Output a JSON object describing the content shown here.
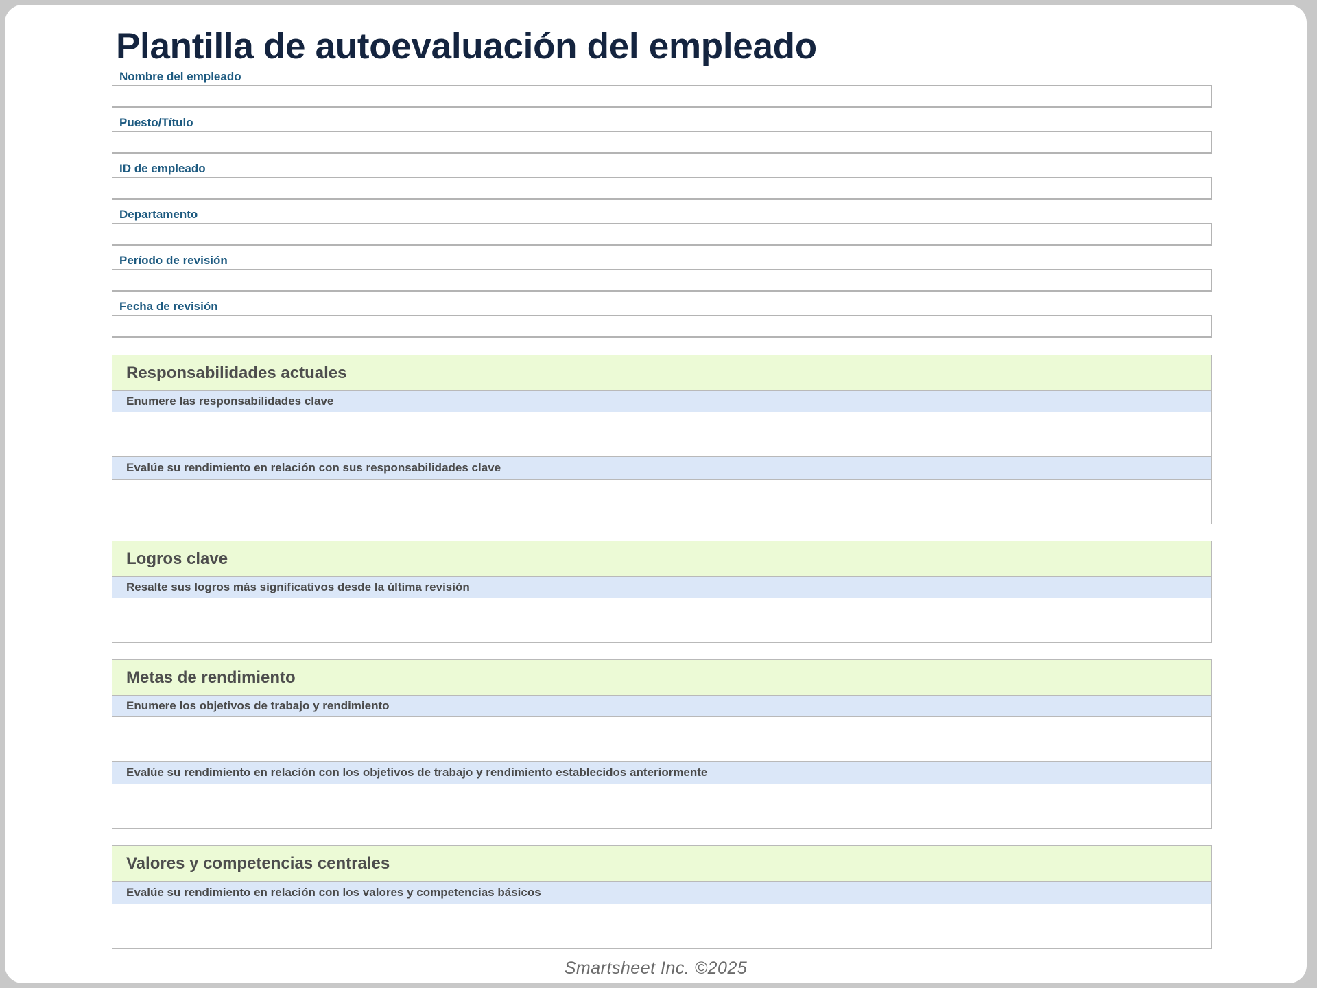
{
  "document": {
    "title": "Plantilla de autoevaluación del empleado",
    "footer": "Smartsheet Inc. ©2025"
  },
  "fields": [
    {
      "label": "Nombre del empleado",
      "value": ""
    },
    {
      "label": "Puesto/Título",
      "value": ""
    },
    {
      "label": "ID de empleado",
      "value": ""
    },
    {
      "label": "Departamento",
      "value": ""
    },
    {
      "label": "Período de revisión",
      "value": ""
    },
    {
      "label": "Fecha de revisión",
      "value": ""
    }
  ],
  "sections": [
    {
      "heading": "Responsabilidades actuales",
      "prompts": [
        {
          "text": "Enumere las responsabilidades clave",
          "answer": ""
        },
        {
          "text": "Evalúe su rendimiento en relación con sus responsabilidades clave",
          "answer": ""
        }
      ]
    },
    {
      "heading": "Logros clave",
      "prompts": [
        {
          "text": "Resalte sus logros más significativos desde la última revisión",
          "answer": ""
        }
      ]
    },
    {
      "heading": "Metas de rendimiento",
      "prompts": [
        {
          "text": "Enumere los objetivos de trabajo y rendimiento",
          "answer": ""
        },
        {
          "text": "Evalúe su rendimiento en relación con los objetivos de trabajo y rendimiento establecidos anteriormente",
          "answer": ""
        }
      ]
    },
    {
      "heading": "Valores y competencias centrales",
      "prompts": [
        {
          "text": "Evalúe su rendimiento en relación con los valores y competencias básicos",
          "answer": ""
        }
      ]
    }
  ],
  "colors": {
    "title": "#14243f",
    "field_label": "#1d5a80",
    "section_header_bg": "#ecfad6",
    "prompt_bg": "#dbe7f8"
  }
}
